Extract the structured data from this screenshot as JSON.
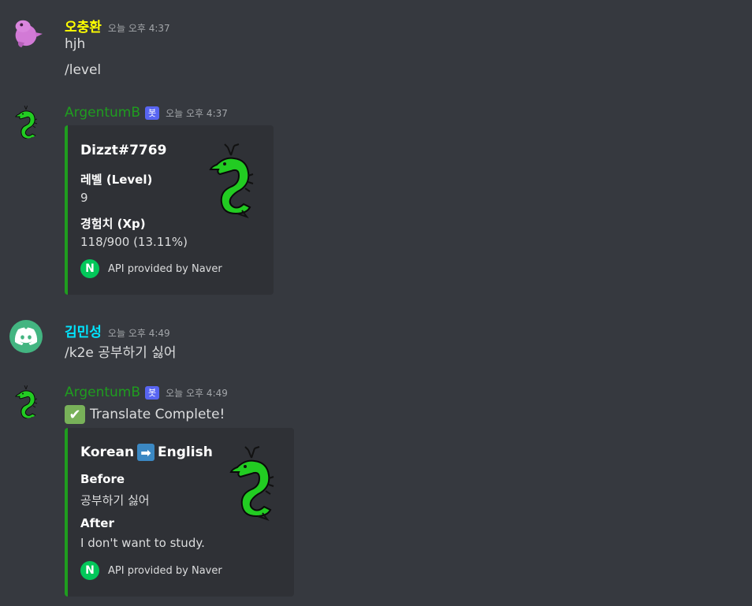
{
  "colors": {
    "background": "#36393f",
    "embed_bg": "#2f3136",
    "embed_border": "#1f9d1f",
    "bot_name": "#1f9d1f",
    "user1_name": "#ffff00",
    "user2_name": "#00e5ff",
    "bot_tag": "#5865f2",
    "naver_green": "#03c75a"
  },
  "messages": [
    {
      "author": "오충환",
      "timestamp": "오늘 오후 4:37",
      "lines": [
        "hjh",
        "/level"
      ]
    },
    {
      "author": "ArgentumB",
      "bot_tag": "봇",
      "timestamp": "오늘 오후 4:37",
      "embed": {
        "title": "Dizzt#7769",
        "fields": [
          {
            "name": "레벨 (Level)",
            "value": "9"
          },
          {
            "name": "경험치 (Xp)",
            "value": "118/900 (13.11%)"
          }
        ],
        "footer": "API provided by Naver",
        "footer_icon": "N"
      }
    },
    {
      "author": "김민성",
      "timestamp": "오늘 오후 4:49",
      "lines": [
        "/k2e 공부하기 싫어"
      ]
    },
    {
      "author": "ArgentumB",
      "bot_tag": "봇",
      "timestamp": "오늘 오후 4:49",
      "text": "Translate Complete!",
      "embed": {
        "title_left": "Korean",
        "title_right": "English",
        "fields": [
          {
            "name": "Before",
            "value": "공부하기 싫어"
          },
          {
            "name": "After",
            "value": "I don't want to study."
          }
        ],
        "footer": "API provided by Naver",
        "footer_icon": "N"
      }
    }
  ]
}
